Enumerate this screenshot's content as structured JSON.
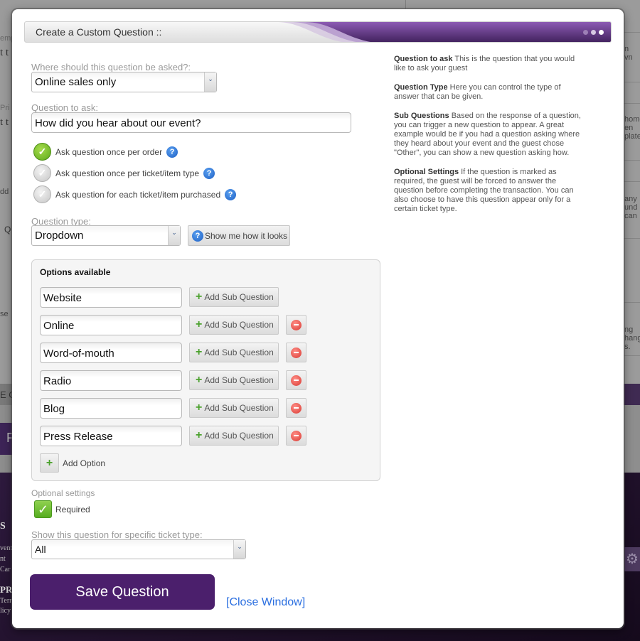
{
  "dialog": {
    "title": "Create a Custom Question ::",
    "accent_color": "#4b1f6c"
  },
  "where_asked": {
    "label": "Where should this question be asked?:",
    "value": "Online sales only"
  },
  "question": {
    "label": "Question to ask:",
    "value": "How did you hear about our event?"
  },
  "ask_frequency": [
    {
      "label": "Ask question once per order",
      "selected": true
    },
    {
      "label": "Ask question once per ticket/item type",
      "selected": false
    },
    {
      "label": "Ask question for each ticket/item purchased",
      "selected": false
    }
  ],
  "question_type": {
    "label": "Question type:",
    "value": "Dropdown",
    "preview_button": "Show me how it looks"
  },
  "options": {
    "title": "Options available",
    "sub_question_label": "Add Sub Question",
    "add_option_label": "Add Option",
    "items": [
      "Website",
      "Online",
      "Word-of-mouth",
      "Radio",
      "Blog",
      "Press Release"
    ]
  },
  "optional_settings": {
    "label": "Optional settings",
    "required_label": "Required",
    "required_checked": true
  },
  "ticket_type": {
    "label": "Show this question for specific ticket type:",
    "value": "All"
  },
  "actions": {
    "save": "Save Question",
    "close": "[Close Window]"
  },
  "help": [
    {
      "title": "Question to ask",
      "text": "This is the question that you would like to ask your guest"
    },
    {
      "title": "Question Type",
      "text": "Here you can control the type of answer that can be given."
    },
    {
      "title": "Sub Questions",
      "text": "Based on the response of a question, you can trigger a new question to appear. A great example would be if you had a question asking where they heard about your event and the guest chose \"Other\", you can show a new question asking how."
    },
    {
      "title": "Optional Settings",
      "text": "If the question is marked as required, the guest will be forced to answer the question before completing the transaction. You can also choose to have this question appear only for a certain ticket type."
    }
  ],
  "background": {
    "left_fragments": [
      "emp",
      "t t",
      "Pri",
      "t t",
      "dd",
      "Q",
      "se",
      "E C",
      "F",
      "S",
      "vent",
      "nt",
      "Car",
      "PRI",
      "Terr",
      "licy"
    ],
    "right_fragments": [
      "n",
      "vn",
      "home",
      "en",
      "plate",
      "any",
      "und",
      "can",
      "ng",
      "hang",
      "s."
    ]
  }
}
